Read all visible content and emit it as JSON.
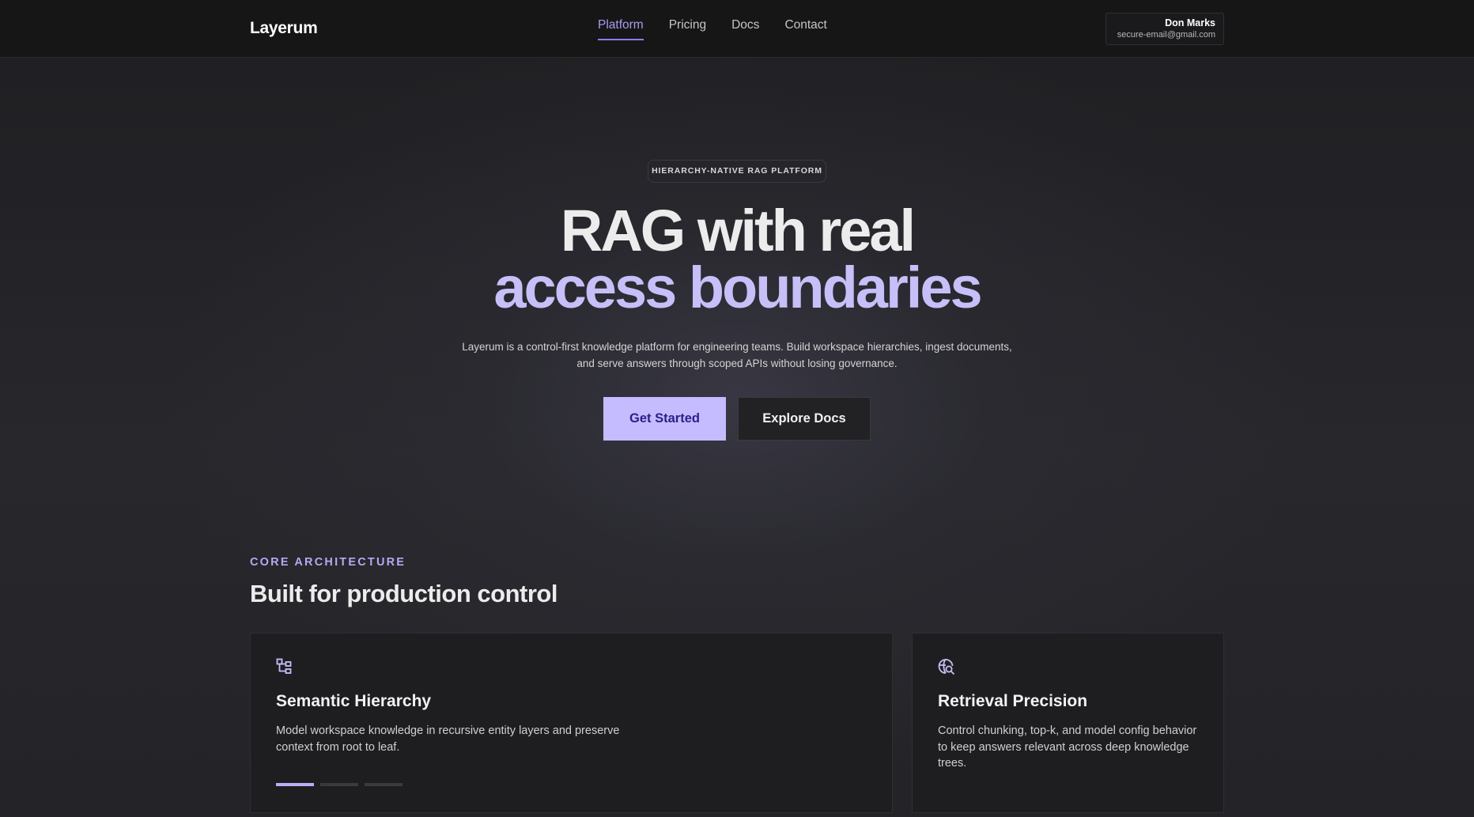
{
  "header": {
    "logo": "Layerum",
    "nav": [
      {
        "label": "Platform",
        "active": true
      },
      {
        "label": "Pricing",
        "active": false
      },
      {
        "label": "Docs",
        "active": false
      },
      {
        "label": "Contact",
        "active": false
      }
    ],
    "user": {
      "name": "Don Marks",
      "email": "secure-email@gmail.com"
    }
  },
  "hero": {
    "badge": "HIERARCHY-NATIVE RAG PLATFORM",
    "title_line1": "RAG with real",
    "title_line2": "access boundaries",
    "description": "Layerum is a control-first knowledge platform for engineering teams. Build workspace hierarchies, ingest documents, and serve answers through scoped APIs without losing governance.",
    "primary_button": "Get Started",
    "secondary_button": "Explore Docs"
  },
  "section": {
    "eyebrow": "CORE ARCHITECTURE",
    "title": "Built for production control"
  },
  "cards": [
    {
      "icon": "hierarchy-icon",
      "title": "Semantic Hierarchy",
      "text": "Model workspace knowledge in recursive entity layers and preserve context from root to leaf."
    },
    {
      "icon": "search-globe-icon",
      "title": "Retrieval Precision",
      "text": "Control chunking, top-k, and model config behavior to keep answers relevant across deep knowledge trees."
    }
  ],
  "carousel": {
    "count": 3,
    "active_index": 0
  },
  "colors": {
    "accent": "#8b7cf0",
    "accent_light": "#c6bff8",
    "primary_button_bg": "#c4bcff",
    "background": "#1c1c1f"
  }
}
